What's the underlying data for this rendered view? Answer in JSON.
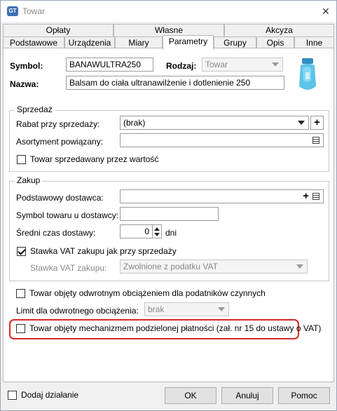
{
  "window": {
    "title": "Towar",
    "app_icon": "GT"
  },
  "tabs_row1": [
    "Opłaty",
    "Własne",
    "Akcyza"
  ],
  "tabs_row2": [
    "Podstawowe",
    "Urządzenia",
    "Miary",
    "Parametry",
    "Grupy",
    "Opis",
    "Inne"
  ],
  "active_tab": "Parametry",
  "header": {
    "symbol_label": "Symbol:",
    "symbol_value": "BANAWULTRA250",
    "rodzaj_label": "Rodzaj:",
    "rodzaj_value": "Towar",
    "nazwa_label": "Nazwa:",
    "nazwa_value": "Balsam do ciała ultranawilżenie i dotlenienie 250"
  },
  "sprzedaz": {
    "title": "Sprzedaż",
    "rabat_label": "Rabat przy sprzedaży:",
    "rabat_value": "(brak)",
    "plus_glyph": "+",
    "asortyment_label": "Asortyment powiązany:",
    "asortyment_value": "",
    "towar_wartosc_label": "Towar sprzedawany przez wartość",
    "towar_wartosc_checked": false
  },
  "zakup": {
    "title": "Zakup",
    "dostawca_label": "Podstawowy dostawca:",
    "dostawca_value": "",
    "symbol_dostawcy_label": "Symbol towaru u dostawcy:",
    "symbol_dostawcy_value": "",
    "czas_label": "Średni czas dostawy:",
    "czas_value": "0",
    "czas_unit": "dni",
    "stawka_vat_jak_label": "Stawka VAT zakupu jak przy sprzedaży",
    "stawka_vat_jak_checked": true,
    "stawka_vat_label": "Stawka VAT zakupu:",
    "stawka_vat_value": "Zwolnione z podatku VAT"
  },
  "odwrotny": {
    "label": "Towar objęty odwrotnym obciążeniem dla podatników czynnych",
    "checked": false,
    "limit_label": "Limit dla odwrotnego obciążenia:",
    "limit_value": "brak"
  },
  "podzielona": {
    "label": "Towar objęty mechanizmem podzielonej płatności (zał. nr 15 do ustawy o VAT)",
    "checked": false
  },
  "footer": {
    "dodaj_label": "Dodaj działanie",
    "dodaj_checked": false,
    "ok": "OK",
    "anuluj": "Anuluj",
    "pomoc": "Pomoc"
  },
  "colors": {
    "highlight": "#d72a2a",
    "product": "#5bc4e8"
  },
  "icons": {
    "close": "close-icon",
    "list": "list-icon",
    "dropdown": "chevron-down-icon"
  }
}
